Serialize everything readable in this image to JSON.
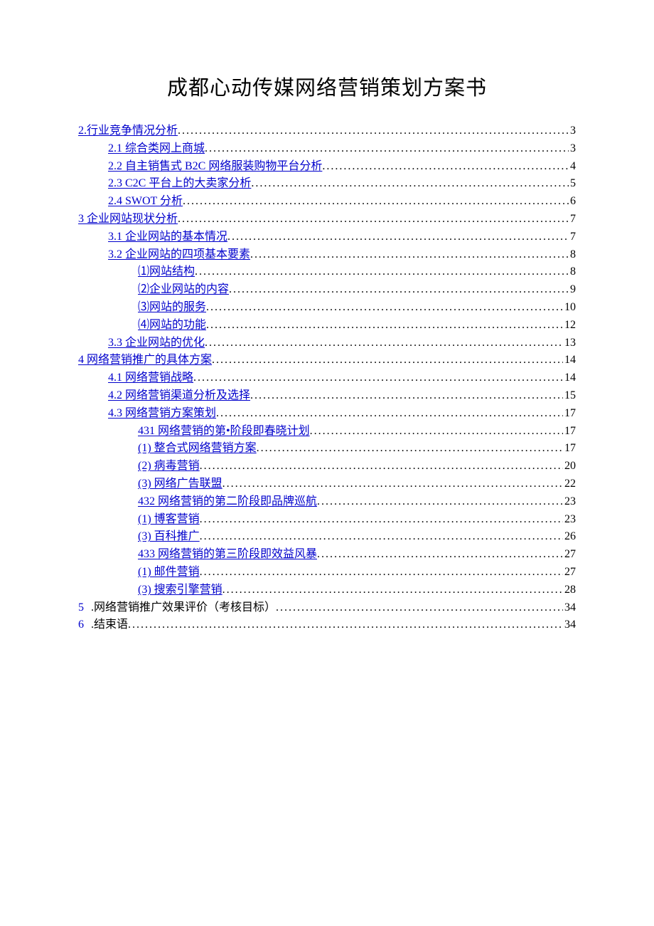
{
  "title": "成都心动传媒网络营销策划方案书",
  "toc": [
    {
      "indent": 0,
      "label": "2.行业竞争情况分析",
      "page": "3",
      "link": true
    },
    {
      "indent": 1,
      "label": "2.1 综合类网上商城",
      "page": "3",
      "link": true
    },
    {
      "indent": 1,
      "label": "2.2 自主销售式 B2C 网络服装购物平台分析",
      "page": "4",
      "link": true
    },
    {
      "indent": 1,
      "label": "2.3 C2C 平台上的大卖家分析",
      "page": "5",
      "link": true
    },
    {
      "indent": 1,
      "label": "2.4 SWOT 分析",
      "page": "6",
      "link": true
    },
    {
      "indent": 0,
      "label": "3 企业网站现状分析",
      "page": "7",
      "link": true
    },
    {
      "indent": 1,
      "label": "3.1 企业网站的基本情况",
      "page": "7",
      "link": true
    },
    {
      "indent": 1,
      "label": "3.2 企业网站的四项基本要素",
      "page": "8",
      "link": true
    },
    {
      "indent": 2,
      "label": "⑴网站结构",
      "page": "8",
      "link": true
    },
    {
      "indent": 2,
      "label": "⑵企业网站的内容",
      "page": "9",
      "link": true
    },
    {
      "indent": 2,
      "label": "⑶网站的服务",
      "page": "10",
      "link": true
    },
    {
      "indent": 2,
      "label": "⑷网站的功能",
      "page": "12",
      "link": true
    },
    {
      "indent": 1,
      "label": "3.3 企业网站的优化",
      "page": "13",
      "link": true
    },
    {
      "indent": 0,
      "label": "4 网络营销推广的具体方案",
      "page": "14",
      "link": true
    },
    {
      "indent": 1,
      "label": "4.1 网络营销战略",
      "page": "14",
      "link": true
    },
    {
      "indent": 1,
      "label": "4.2 网络营销渠道分析及选择",
      "page": "15",
      "link": true
    },
    {
      "indent": 1,
      "label": "4.3 网络营销方案策划",
      "page": "17",
      "link": true
    },
    {
      "indent": 2,
      "label": "431 网络营销的第•阶段即春晓计划",
      "page": "17",
      "link": true
    },
    {
      "indent": 3,
      "label": "(1) 整合式网络营销方案",
      "page": "17",
      "link": true
    },
    {
      "indent": 3,
      "label": "(2) 病毒营销",
      "page": "20",
      "link": true
    },
    {
      "indent": 3,
      "label": "(3) 网络广告联盟",
      "page": "22",
      "link": true
    },
    {
      "indent": 2,
      "label": "432 网络营销的第二阶段即品牌巡航",
      "page": "23",
      "link": true
    },
    {
      "indent": 3,
      "label": "(1) 博客营销",
      "page": "23",
      "link": true
    },
    {
      "indent": 3,
      "label": "(3) 百科推广",
      "page": "26",
      "link": true
    },
    {
      "indent": 2,
      "label": "433 网络营销的第三阶段即效益风暴",
      "page": "27",
      "link": true
    },
    {
      "indent": 3,
      "label": "(1) 邮件营销",
      "page": "27",
      "link": true
    },
    {
      "indent": 3,
      "label": "(3) 搜索引擎营销",
      "page": "28",
      "link": true
    },
    {
      "indent": 0,
      "numPrefix": "5",
      "label": ".网络营销推广效果评价（考核目标）",
      "page": "34",
      "link": false
    },
    {
      "indent": 0,
      "numPrefix": "6",
      "label": ".结束语",
      "page": "34",
      "link": false
    }
  ]
}
